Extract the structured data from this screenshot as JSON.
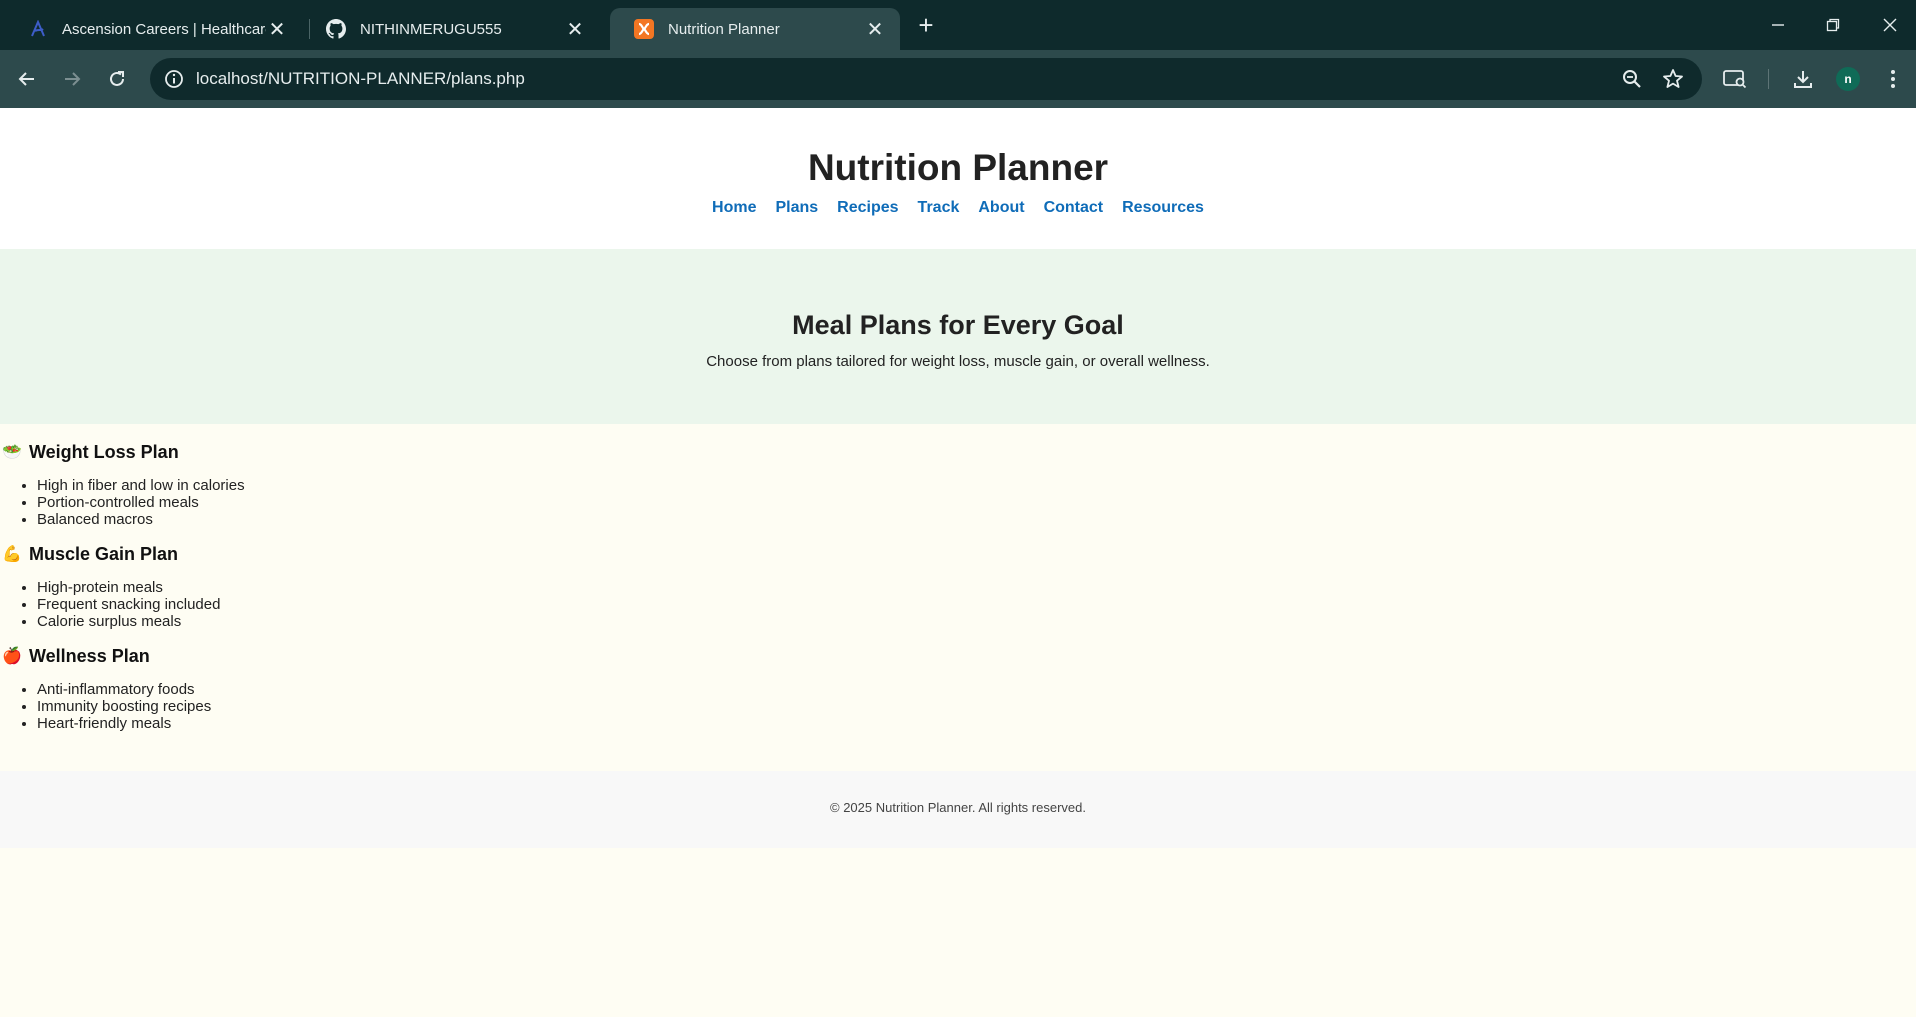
{
  "browser": {
    "tabs": [
      {
        "title": "Ascension Careers | Healthcare Jobs",
        "icon": "ascension-logo-icon",
        "active": false
      },
      {
        "title": "NITHINMERUGU555",
        "icon": "github-icon",
        "active": false
      },
      {
        "title": "Nutrition Planner",
        "icon": "xampp-icon",
        "active": true
      }
    ],
    "close_glyph": "✕",
    "new_tab_glyph": "+",
    "url": "localhost/NUTRITION-PLANNER/plans.php",
    "profile_initial": "n",
    "colors": {
      "tabstrip": "#0e2a2c",
      "toolbar": "#2d4a4c",
      "omnibox": "#0f2a2c",
      "profile": "#0f6b57"
    }
  },
  "site": {
    "title": "Nutrition Planner",
    "nav": [
      "Home",
      "Plans",
      "Recipes",
      "Track",
      "About",
      "Contact",
      "Resources"
    ],
    "link_color": "#0f6cb8"
  },
  "hero": {
    "heading": "Meal Plans for Every Goal",
    "subtext": "Choose from plans tailored for weight loss, muscle gain, or overall wellness.",
    "background": "#ebf6ec"
  },
  "plans": [
    {
      "emoji": "🥗",
      "title": "Weight Loss Plan",
      "items": [
        "High in fiber and low in calories",
        "Portion-controlled meals",
        "Balanced macros"
      ]
    },
    {
      "emoji": "💪",
      "title": "Muscle Gain Plan",
      "items": [
        "High-protein meals",
        "Frequent snacking included",
        "Calorie surplus meals"
      ]
    },
    {
      "emoji": "🍎",
      "title": "Wellness Plan",
      "items": [
        "Anti-inflammatory foods",
        "Immunity boosting recipes",
        "Heart-friendly meals"
      ]
    }
  ],
  "footer": {
    "text": "© 2025 Nutrition Planner. All rights reserved."
  }
}
